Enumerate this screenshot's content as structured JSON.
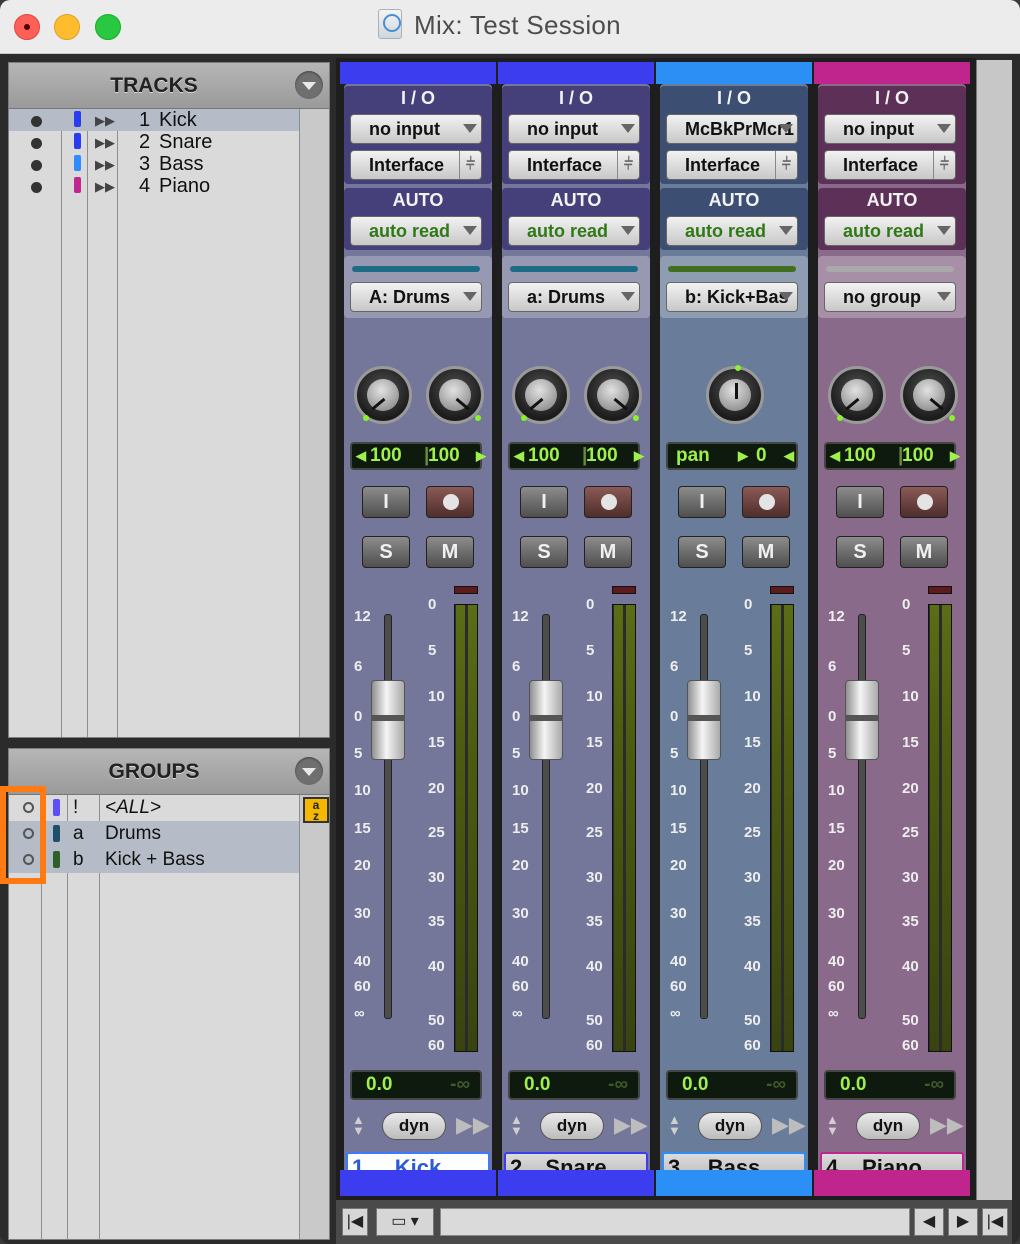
{
  "window": {
    "title": "Mix: Test Session"
  },
  "tracks_panel": {
    "title": "TRACKS",
    "tracks": [
      {
        "num": "1",
        "name": "Kick",
        "color": "#2a3cf0",
        "selected": true
      },
      {
        "num": "2",
        "name": "Snare",
        "color": "#2a3cf0",
        "selected": false
      },
      {
        "num": "3",
        "name": "Bass",
        "color": "#2e8cff",
        "selected": false
      },
      {
        "num": "4",
        "name": "Piano",
        "color": "#c2268f",
        "selected": false
      }
    ]
  },
  "groups_panel": {
    "title": "GROUPS",
    "sort_icon": "a-z-sort-icon",
    "groups": [
      {
        "id": "!",
        "name": "<ALL>",
        "color": "#5b4ff5",
        "selected": false
      },
      {
        "id": "a",
        "name": "Drums",
        "color": "#1f4f6b",
        "selected": true
      },
      {
        "id": "b",
        "name": "Kick + Bass",
        "color": "#2f5f2a",
        "selected": true
      }
    ]
  },
  "mixer": {
    "io_label": "I / O",
    "auto_label": "AUTO",
    "strips": [
      {
        "num": "1",
        "name": "Kick",
        "color": "#3d3df0",
        "body": "#74779a",
        "head": "#453f7a",
        "input": "no input",
        "output": "Interface",
        "auto": "auto read",
        "group": "A: Drums",
        "group_bar": "#1e6b86",
        "stereo_pan": true,
        "pan_left": "100",
        "pan_right": "100",
        "volume": "0.0",
        "peak": "-∞",
        "insert": "dyn",
        "name_selected": true
      },
      {
        "num": "2",
        "name": "Snare",
        "color": "#3d3df0",
        "body": "#74779a",
        "head": "#453f7a",
        "input": "no input",
        "output": "Interface",
        "auto": "auto read",
        "group": "a: Drums",
        "group_bar": "#1e6b86",
        "stereo_pan": true,
        "pan_left": "100",
        "pan_right": "100",
        "volume": "0.0",
        "peak": "-∞",
        "insert": "dyn",
        "name_selected": false
      },
      {
        "num": "3",
        "name": "Bass",
        "color": "#2b8ff5",
        "body": "#697c99",
        "head": "#3c4f72",
        "input": "McBkPrMcr1",
        "output": "Interface",
        "auto": "auto read",
        "group": "b: Kick+Bas",
        "group_bar": "#3f6f1f",
        "stereo_pan": false,
        "pan_label": "pan",
        "pan_value": "0",
        "volume": "0.0",
        "peak": "-∞",
        "insert": "dyn",
        "name_selected": false
      },
      {
        "num": "4",
        "name": "Piano",
        "color": "#c0258d",
        "body": "#8a6a8a",
        "head": "#5d3058",
        "input": "no input",
        "output": "Interface",
        "auto": "auto read",
        "group": "no group",
        "group_bar": "#a9a9a9",
        "stereo_pan": true,
        "pan_left": "100",
        "pan_right": "100",
        "volume": "0.0",
        "peak": "-∞",
        "insert": "dyn",
        "name_selected": false
      }
    ],
    "fader_scale": [
      "12",
      "6",
      "0",
      "5",
      "10",
      "15",
      "20",
      "30",
      "40",
      "60",
      "∞"
    ],
    "meter_scale": [
      "0",
      "5",
      "10",
      "15",
      "20",
      "25",
      "30",
      "35",
      "40",
      "50",
      "60"
    ],
    "solo_label": "S",
    "mute_label": "M",
    "input_label": "I"
  }
}
